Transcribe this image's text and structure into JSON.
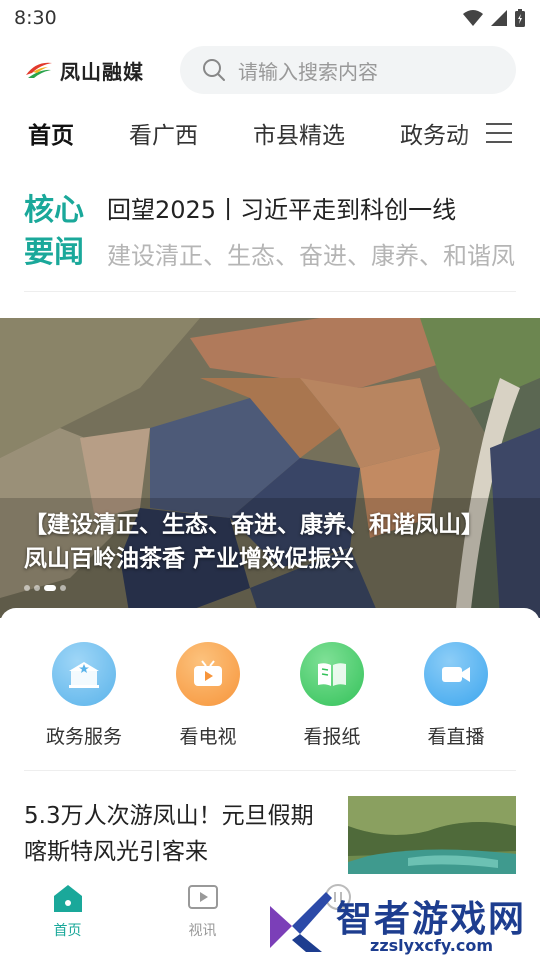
{
  "status_bar": {
    "time": "8:30"
  },
  "header": {
    "brand_name": "凤山融媒",
    "search_placeholder": "请输入搜索内容"
  },
  "nav": {
    "tabs": [
      "首页",
      "看广西",
      "市县精选",
      "政务动"
    ]
  },
  "news_flash": {
    "label": "核心要闻",
    "headline": "回望2025丨习近平走到科创一线",
    "subline": "建设清正、生态、奋进、康养、和谐凤山"
  },
  "banner": {
    "caption": "【建设清正、生态、奋进、康养、和谐凤山】凤山百岭油茶香 产业增效促振兴",
    "slides": 4,
    "active_slide": 3
  },
  "services": [
    {
      "label": "政务服务",
      "icon": "government-icon",
      "color": "#5ab3ea"
    },
    {
      "label": "看电视",
      "icon": "tv-icon",
      "color": "#f7953b"
    },
    {
      "label": "看报纸",
      "icon": "newspaper-icon",
      "color": "#34c25a"
    },
    {
      "label": "看直播",
      "icon": "live-camera-icon",
      "color": "#3da6ee"
    }
  ],
  "article": {
    "title": "5.3万人次游凤山！元旦假期喀斯特风光引客来"
  },
  "tabbar": {
    "items": [
      "首页",
      "视讯"
    ]
  },
  "watermark": {
    "title": "智者游戏网",
    "url": "zzslyxcfy.com"
  },
  "colors": {
    "accent": "#1aa89a"
  }
}
